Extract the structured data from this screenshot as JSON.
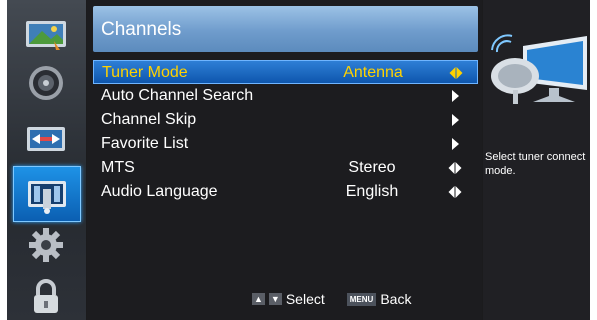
{
  "menu": {
    "title": "Channels",
    "items": [
      {
        "label": "Tuner Mode",
        "value": "Antenna",
        "control": "left-right-icon",
        "selected": true
      },
      {
        "label": "Auto Channel Search",
        "value": "",
        "control": "right-arrow-icon",
        "selected": false
      },
      {
        "label": "Channel Skip",
        "value": "",
        "control": "right-arrow-icon",
        "selected": false
      },
      {
        "label": "Favorite List",
        "value": "",
        "control": "right-arrow-icon",
        "selected": false
      },
      {
        "label": "MTS",
        "value": "Stereo",
        "control": "left-right-icon",
        "selected": false
      },
      {
        "label": "Audio Language",
        "value": "English",
        "control": "left-right-icon",
        "selected": false
      }
    ]
  },
  "footer": {
    "select_label": "Select",
    "menu_key": "MENU",
    "back_label": "Back"
  },
  "info": {
    "description": "Select tuner connect mode."
  },
  "sidebar": {
    "icons": [
      "picture-icon",
      "sound-icon",
      "settings-display-icon",
      "channels-icon",
      "gear-icon",
      "lock-icon"
    ],
    "active": "channels-icon"
  },
  "colors": {
    "selected_text": "#ffd200",
    "highlight": "#1e7fd8",
    "title_bar": "#7fa8d4",
    "background": "#1c1c1f"
  }
}
